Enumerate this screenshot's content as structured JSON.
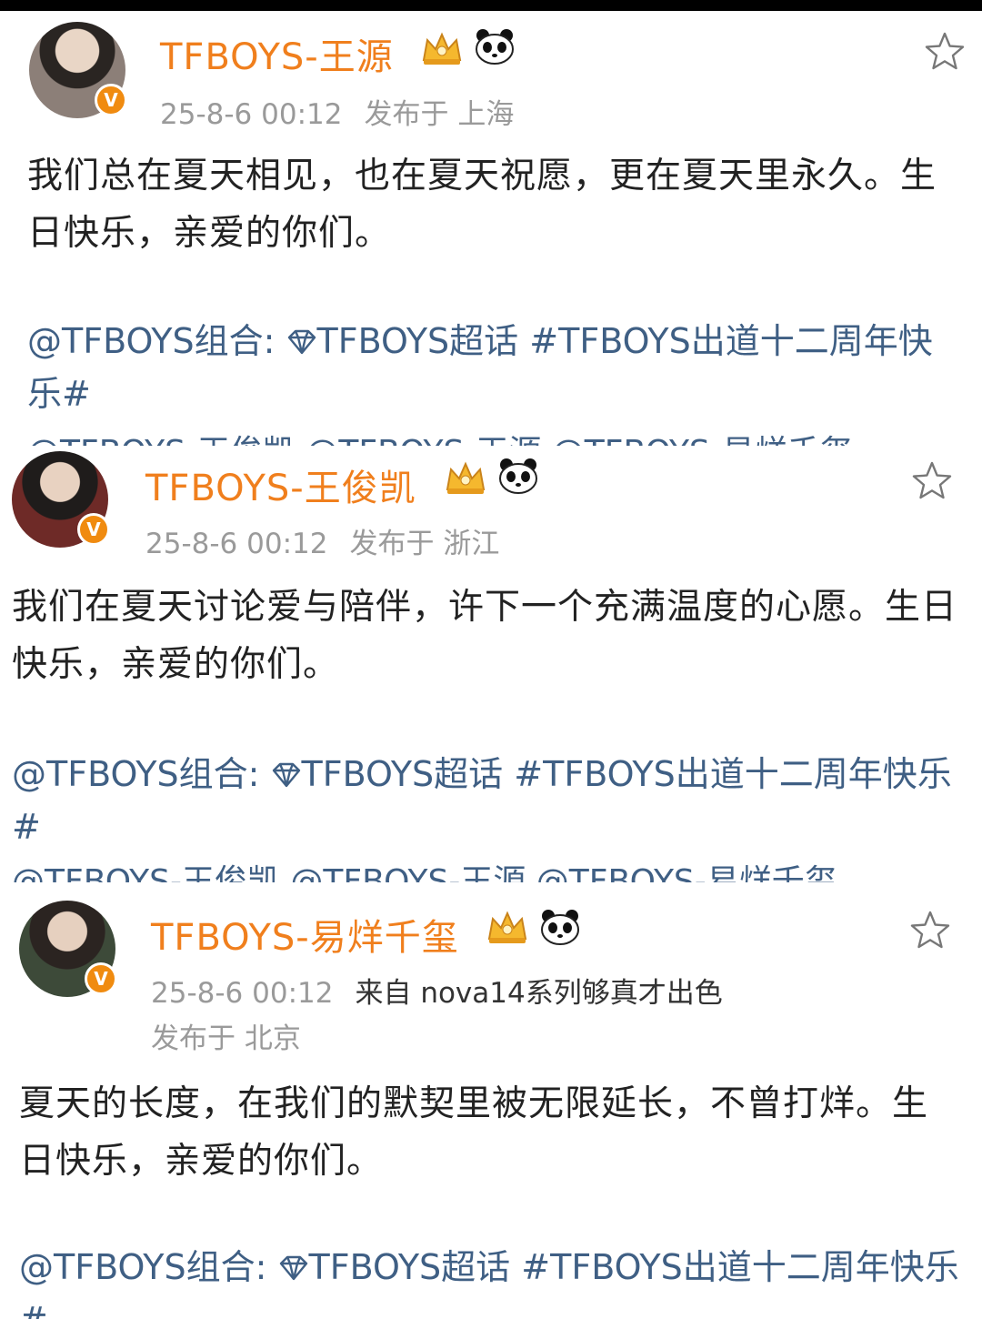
{
  "posts": [
    {
      "username": "TFBOYS-王源",
      "time": "25-8-6 00:12",
      "location": "发布于 上海",
      "content": "我们总在夏天相见，也在夏天祝愿，更在夏天里永久。生日快乐，亲爱的你们。",
      "mention": "@TFBOYS组合:",
      "supertopic": "TFBOYS超话",
      "hashtag": "#TFBOYS出道十二周年快乐#",
      "cutoff": "@TFBOYS-王俊凯 @TFBOYS-王源 @TFBOYS-易烊千玺"
    },
    {
      "username": "TFBOYS-王俊凯",
      "time": "25-8-6 00:12",
      "location": "发布于 浙江",
      "content": "我们在夏天讨论爱与陪伴，许下一个充满温度的心愿。生日快乐，亲爱的你们。",
      "mention": "@TFBOYS组合:",
      "supertopic": "TFBOYS超话",
      "hashtag": "#TFBOYS出道十二周年快乐#",
      "cutoff": "@TFBOYS-王俊凯 @TFBOYS-王源 @TFBOYS-易烊千玺"
    },
    {
      "username": "TFBOYS-易烊千玺",
      "time": "25-8-6 00:12",
      "source": "来自 nova14系列够真才出色",
      "location": "发布于 北京",
      "content": "夏天的长度，在我们的默契里被无限延长，不曾打烊。生日快乐，亲爱的你们。",
      "mention": "@TFBOYS组合:",
      "supertopic": "TFBOYS超话",
      "hashtag": "#TFBOYS出道十二周年快乐#"
    }
  ],
  "icons": {
    "verified_badge": "v-badge-icon",
    "crown": "crown-icon",
    "panda": "panda-icon",
    "favorite": "star-outline-icon",
    "supertopic": "diamond-icon"
  },
  "colors": {
    "username": "#f07f1d",
    "meta": "#9a9a9a",
    "link": "#3f5f84",
    "badge": "#f08b10"
  }
}
